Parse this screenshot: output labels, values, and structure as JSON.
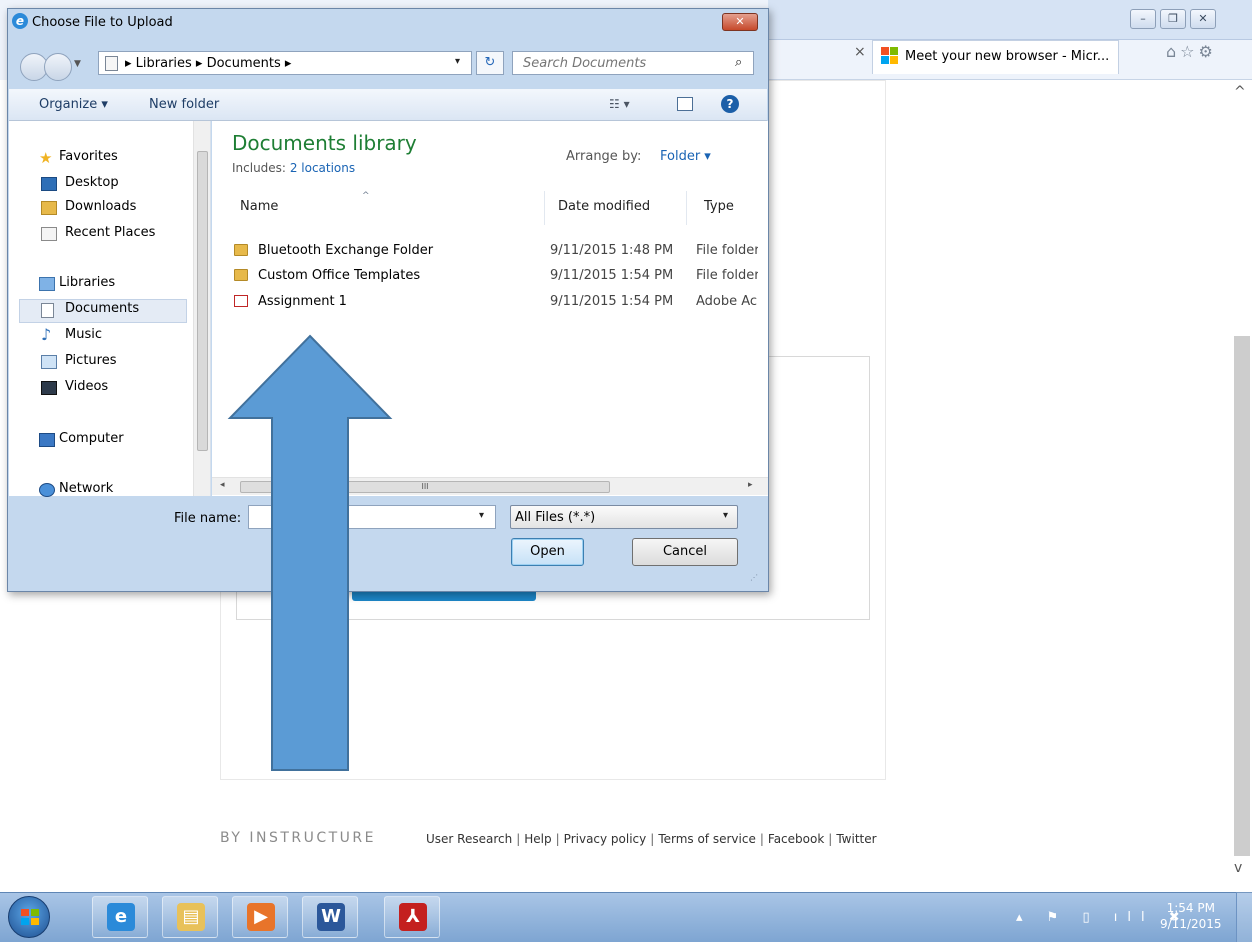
{
  "browser": {
    "window_controls": {
      "minimize": "–",
      "restore": "❐",
      "close": "✕"
    },
    "tab_close": "×",
    "active_tab": {
      "label": "Meet your new browser - Micr...",
      "logo_colors": [
        "#f25022",
        "#7fba00",
        "#00a4ef",
        "#ffb900"
      ]
    },
    "nav_icons": "⌂☆⚙",
    "scroll_up": "^",
    "scroll_down": "v"
  },
  "page": {
    "footer_brand": "BY INSTRUCTURE",
    "footer_links": [
      "User Research",
      "Help",
      "Privacy policy",
      "Terms of service",
      "Facebook",
      "Twitter"
    ],
    "footer_sep": "|",
    "accent_button_color": "#1d86c8"
  },
  "dialog": {
    "title": "Choose File to Upload",
    "title_icon": "e",
    "close": "✕",
    "address": {
      "path": "▸ Libraries ▸ Documents ▸",
      "dropdown": "▾"
    },
    "refresh": "↻",
    "search": {
      "placeholder": "Search Documents",
      "icon": "⌕"
    },
    "toolbar": {
      "organize": "Organize ▾",
      "new_folder": "New folder",
      "view": "☷ ▾",
      "help": "?"
    },
    "nav": {
      "favorites": "Favorites",
      "desktop": "Desktop",
      "downloads": "Downloads",
      "recent_places": "Recent Places",
      "libraries": "Libraries",
      "documents": "Documents",
      "music": "Music",
      "pictures": "Pictures",
      "videos": "Videos",
      "computer": "Computer",
      "network": "Network"
    },
    "content": {
      "library_title": "Documents library",
      "includes_label": "Includes:",
      "includes_link": "2 locations",
      "arrange_label": "Arrange by:",
      "arrange_value": "Folder ▾",
      "columns": {
        "name": "Name",
        "date": "Date modified",
        "type": "Type"
      },
      "sort_arrow": "^",
      "rows": [
        {
          "name": "Bluetooth Exchange Folder",
          "date": "9/11/2015 1:48 PM",
          "type": "File folder"
        },
        {
          "name": "Custom Office Templates",
          "date": "9/11/2015 1:54 PM",
          "type": "File folder"
        },
        {
          "name": "Assignment 1",
          "date": "9/11/2015 1:54 PM",
          "type": "Adobe Ac"
        }
      ],
      "hscroll_grip": "III"
    },
    "filename_label": "File name:",
    "filename_value": "",
    "filename_drop": "▾",
    "filetype_value": "All Files (*.*)",
    "filetype_drop": "▾",
    "open_label": "Open",
    "cancel_label": "Cancel",
    "resize_grip": "⋰"
  },
  "annotation": {
    "arrow_color": "#5b9bd5",
    "arrow_stroke": "#41719c"
  },
  "taskbar": {
    "apps": [
      {
        "name": "internet-explorer",
        "glyph": "e",
        "color": "#2b8ad9"
      },
      {
        "name": "file-explorer",
        "glyph": "▤",
        "color": "#e8c15a"
      },
      {
        "name": "media-player",
        "glyph": "▶",
        "color": "#e8742a"
      },
      {
        "name": "word",
        "glyph": "W",
        "color": "#2b579a"
      },
      {
        "name": "acrobat",
        "glyph": "⅄",
        "color": "#c4201f"
      }
    ],
    "tray": "▴ ⚑ ▯ ıll ✖",
    "time": "1:54 PM",
    "date": "9/11/2015"
  }
}
